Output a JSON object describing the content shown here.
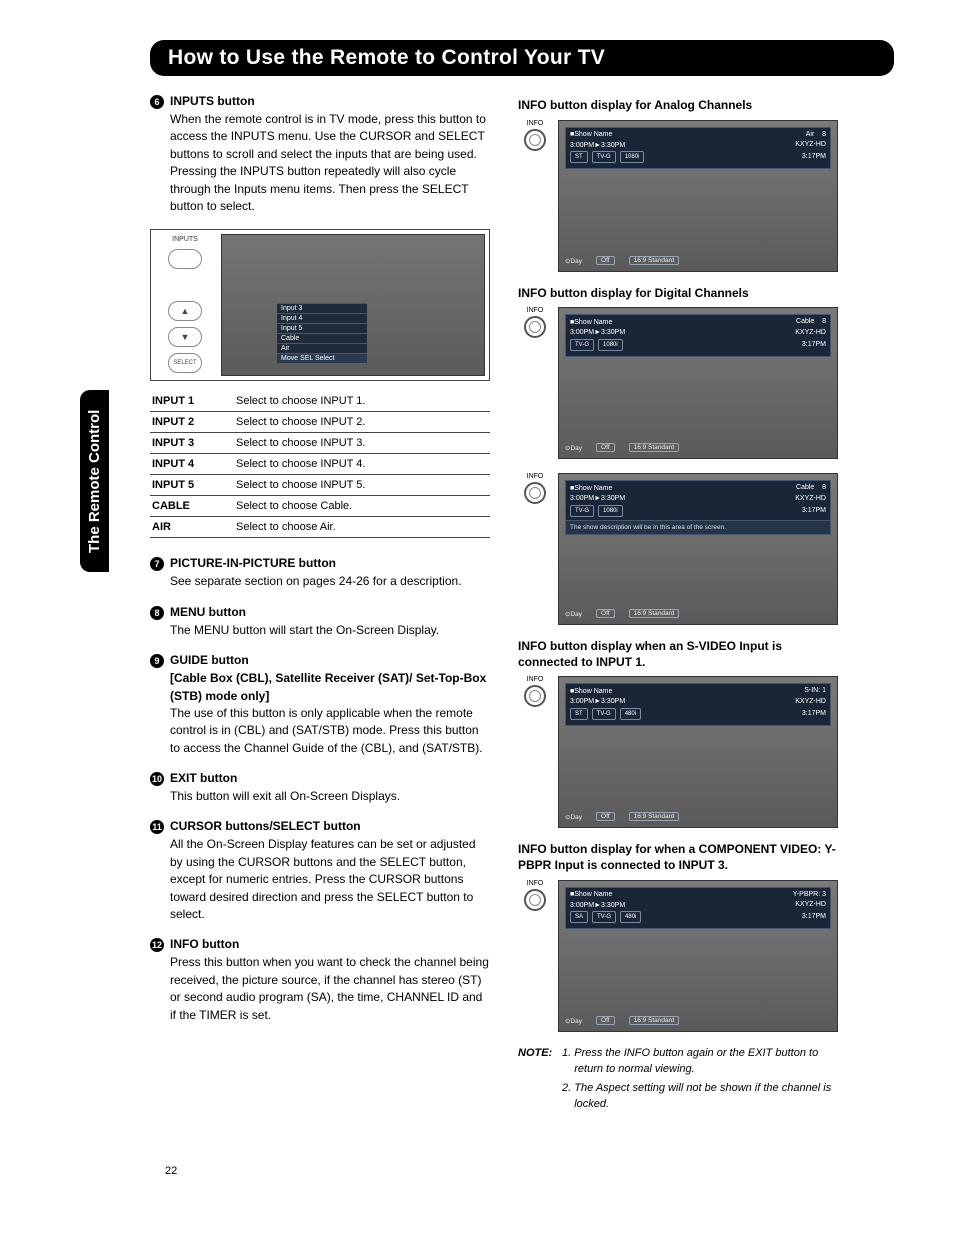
{
  "pageTitle": "How to Use the Remote to Control Your TV",
  "sideTab": "The Remote Control",
  "pageNumber": "22",
  "items": {
    "i6": {
      "num": "6",
      "title": "INPUTS button",
      "body": "When the remote control is in TV mode, press this button to access the INPUTS menu. Use the CURSOR and SELECT buttons to scroll and select the inputs that are being used. Pressing the INPUTS button repeatedly will also cycle through the Inputs menu items. Then press the SELECT button to select."
    },
    "i7": {
      "num": "7",
      "title": "PICTURE-IN-PICTURE button",
      "body": "See separate section on pages 24-26 for a description."
    },
    "i8": {
      "num": "8",
      "title": "MENU button",
      "body": "The MENU button will start the On-Screen Display."
    },
    "i9": {
      "num": "9",
      "title": "GUIDE button",
      "sub": "[Cable Box (CBL), Satellite Receiver (SAT)/ Set-Top-Box (STB) mode only]",
      "body": "The use of this button is only applicable when the remote control is in (CBL) and (SAT/STB) mode. Press this button to access the Channel Guide of the (CBL), and (SAT/STB)."
    },
    "i10": {
      "num": "10",
      "title": "EXIT button",
      "body": "This button will exit all On-Screen Displays."
    },
    "i11": {
      "num": "11",
      "title": "CURSOR buttons/SELECT button",
      "body": "All the On-Screen Display features can be set or adjusted by using the CURSOR buttons and the SELECT button, except for numeric entries. Press the CURSOR buttons toward desired direction and press the SELECT button to select."
    },
    "i12": {
      "num": "12",
      "title": "INFO button",
      "body": "Press this button when you want to check the channel being received, the picture source, if the channel has stereo (ST) or second audio program (SA), the time, CHANNEL ID and if the TIMER is set."
    }
  },
  "inputsGraphic": {
    "labelInputs": "INPUTS",
    "labelSelect": "SELECT",
    "menu": [
      "Input 3",
      "Input 4",
      "Input 5",
      "Cable",
      "Air"
    ],
    "hint": "Move      SEL Select",
    "arrowUp": "▲",
    "arrowDown": "▼"
  },
  "inputsTable": [
    {
      "k": "INPUT 1",
      "v": "Select to choose INPUT 1."
    },
    {
      "k": "INPUT 2",
      "v": "Select to choose INPUT 2."
    },
    {
      "k": "INPUT 3",
      "v": "Select to choose INPUT 3."
    },
    {
      "k": "INPUT 4",
      "v": "Select to choose INPUT 4."
    },
    {
      "k": "INPUT 5",
      "v": "Select to choose INPUT 5."
    },
    {
      "k": "CABLE",
      "v": "Select to choose Cable."
    },
    {
      "k": "AIR",
      "v": "Select to choose Air."
    }
  ],
  "right": {
    "analogHead": "INFO button display for Analog Channels",
    "digitalHead": "INFO button display for Digital Channels",
    "svideoHead": "INFO button display when an S-VIDEO Input is connected to INPUT 1.",
    "componentHead": "INFO button display for when a COMPONENT VIDEO: Y-PBPR Input is connected to INPUT 3.",
    "infoLabel": "INFO",
    "showName": "Show Name",
    "time": "3:00PM►3:30PM",
    "clock": "3:17PM",
    "station": "KXYZ-HD",
    "srcAir": "Air",
    "srcCable": "Cable",
    "srcSin": "S-IN: 1",
    "srcYpbpr": "Y-PBPR: 3",
    "ch": "8",
    "pills": {
      "st": "ST",
      "sa": "SA",
      "tvg": "TV-G",
      "r1080i": "1080i",
      "r480i": "480i"
    },
    "desc": "The show description will be in this area of the screen.",
    "footer": {
      "day": "Day",
      "off": "Off",
      "aspect": "16:9 Standard"
    }
  },
  "note": {
    "label": "NOTE:",
    "n1": "Press the INFO button again or the EXIT button to return to normal viewing.",
    "n2": "The Aspect setting will not be shown if the channel is locked."
  }
}
